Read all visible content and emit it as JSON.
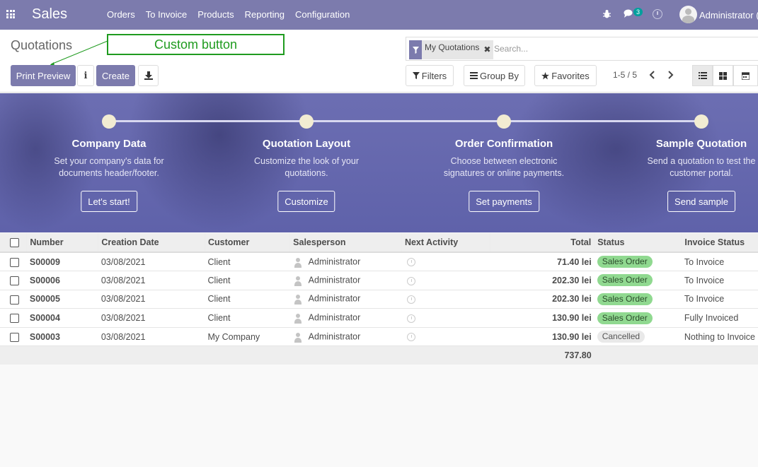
{
  "navbar": {
    "brand": "Sales",
    "menu": [
      "Orders",
      "To Invoice",
      "Products",
      "Reporting",
      "Configuration"
    ],
    "chat_count": "3",
    "user": "Administrator (i"
  },
  "control_panel": {
    "title": "Quotations",
    "annotation": "Custom button",
    "print_preview": "Print Preview",
    "info_icon_glyph": "i",
    "create": "Create",
    "facet_label": "My Quotations",
    "facet_remove": "✖",
    "search_placeholder": "Search...",
    "filters": "Filters",
    "group_by": "Group By",
    "favorites": "Favorites",
    "pager": "1-5 / 5"
  },
  "banner": {
    "steps": [
      {
        "title": "Company Data",
        "desc1": "Set your company's data for",
        "desc2": "documents header/footer.",
        "button": "Let's start!"
      },
      {
        "title": "Quotation Layout",
        "desc1": "Customize the look of your",
        "desc2": "quotations.",
        "button": "Customize"
      },
      {
        "title": "Order Confirmation",
        "desc1": "Choose between electronic",
        "desc2": "signatures or online payments.",
        "button": "Set payments"
      },
      {
        "title": "Sample Quotation",
        "desc1": "Send a quotation to test the",
        "desc2": "customer portal.",
        "button": "Send sample"
      }
    ]
  },
  "table": {
    "headers": [
      "Number",
      "Creation Date",
      "Customer",
      "Salesperson",
      "Next Activity",
      "Total",
      "Status",
      "Invoice Status"
    ],
    "rows": [
      {
        "number": "S00009",
        "date": "03/08/2021",
        "customer": "Client",
        "salesperson": "Administrator",
        "total": "71.40 lei",
        "status": "Sales Order",
        "invoice_status": "To Invoice"
      },
      {
        "number": "S00006",
        "date": "03/08/2021",
        "customer": "Client",
        "salesperson": "Administrator",
        "total": "202.30 lei",
        "status": "Sales Order",
        "invoice_status": "To Invoice"
      },
      {
        "number": "S00005",
        "date": "03/08/2021",
        "customer": "Client",
        "salesperson": "Administrator",
        "total": "202.30 lei",
        "status": "Sales Order",
        "invoice_status": "To Invoice"
      },
      {
        "number": "S00004",
        "date": "03/08/2021",
        "customer": "Client",
        "salesperson": "Administrator",
        "total": "130.90 lei",
        "status": "Sales Order",
        "invoice_status": "Fully Invoiced"
      },
      {
        "number": "S00003",
        "date": "03/08/2021",
        "customer": "My Company",
        "salesperson": "Administrator",
        "total": "130.90 lei",
        "status": "Cancelled",
        "invoice_status": "Nothing to Invoice"
      }
    ],
    "sum_total": "737.80"
  },
  "colors": {
    "brand": "#7c7bad",
    "annotation": "#1f9b1f",
    "sales_order_badge": "#90d990"
  }
}
